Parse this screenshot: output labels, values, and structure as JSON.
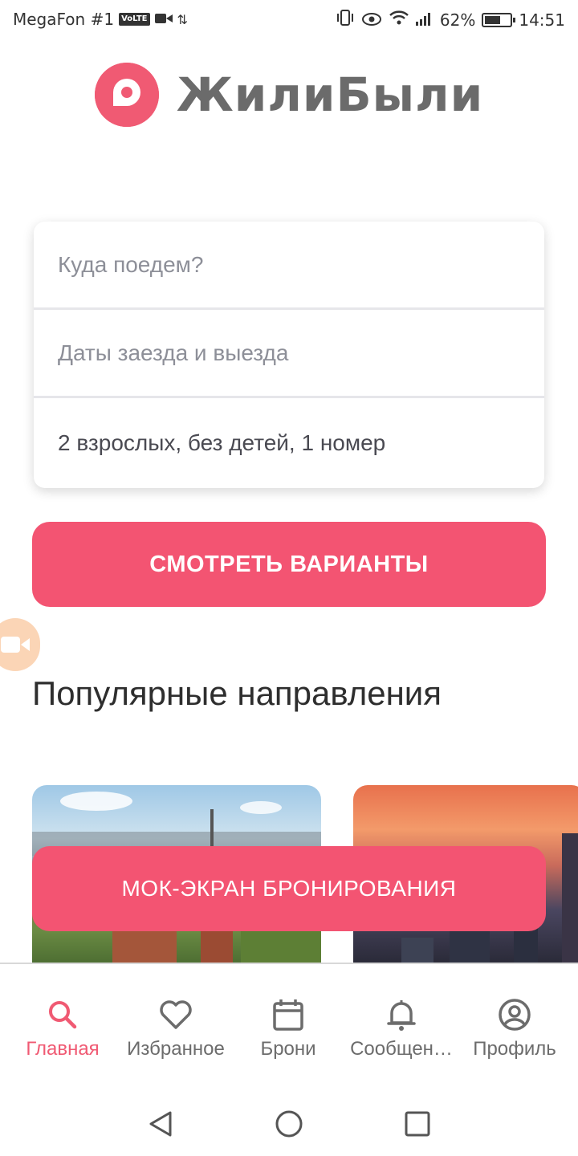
{
  "status_bar": {
    "carrier": "MegaFon #1",
    "volte": "VoLTE",
    "battery_percent": "62%",
    "battery_level": 0.62,
    "time": "14:51"
  },
  "logo": {
    "text": "ЖилиБыли"
  },
  "search": {
    "destination_placeholder": "Куда поедем?",
    "dates_placeholder": "Даты заезда и выезда",
    "guests_value": "2 взрослых, без детей, 1 номер"
  },
  "primary_button": {
    "label": "СМОТРЕТЬ ВАРИАНТЫ"
  },
  "popular": {
    "title": "Популярные направления"
  },
  "overlay_button": {
    "label": "МОК-ЭКРАН БРОНИРОВАНИЯ"
  },
  "bottom_nav": {
    "items": [
      {
        "label": "Главная",
        "icon": "search-icon",
        "active": true
      },
      {
        "label": "Избранное",
        "icon": "heart-icon",
        "active": false
      },
      {
        "label": "Брони",
        "icon": "calendar-icon",
        "active": false
      },
      {
        "label": "Сообщен…",
        "icon": "bell-icon",
        "active": false
      },
      {
        "label": "Профиль",
        "icon": "profile-icon",
        "active": false
      }
    ]
  },
  "colors": {
    "accent": "#f35472",
    "text": "#3a3a3a",
    "muted": "#8d8f98",
    "nav_inactive": "#6c6c6c"
  }
}
